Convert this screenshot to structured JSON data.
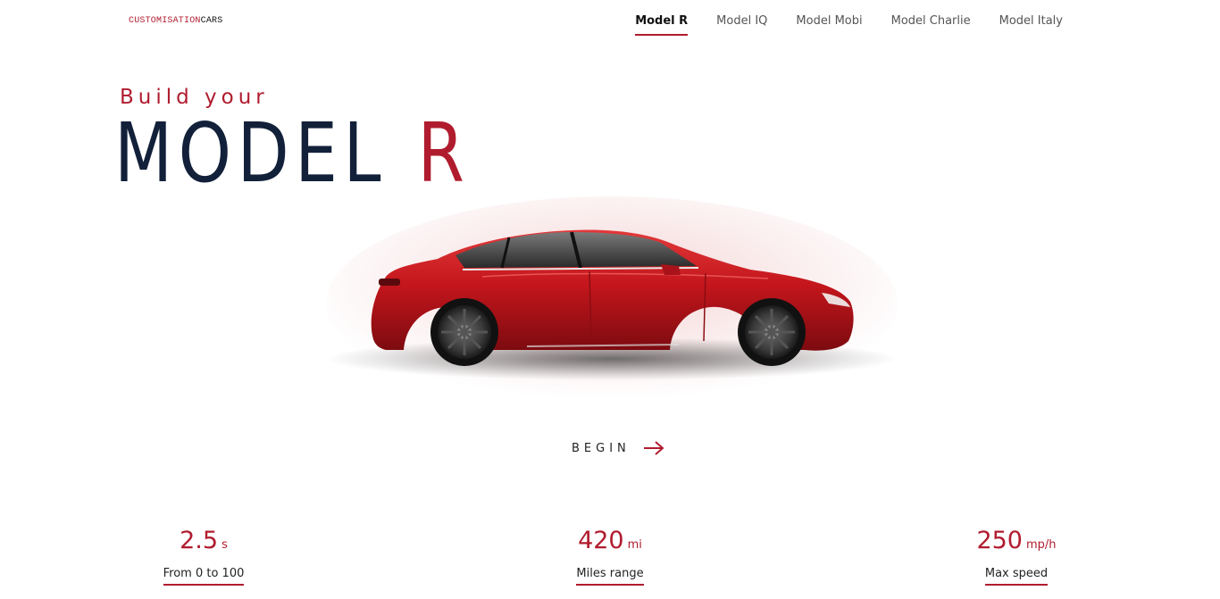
{
  "logo": {
    "part1": "CUSTOMISATION",
    "part2": "CARS"
  },
  "nav": {
    "items": [
      {
        "label": "Model R"
      },
      {
        "label": "Model IQ"
      },
      {
        "label": "Model Mobi"
      },
      {
        "label": "Model Charlie"
      },
      {
        "label": "Model Italy"
      }
    ],
    "active_index": 0
  },
  "hero": {
    "subtitle": "Build your",
    "title_main": "MODEL",
    "title_accent": "R",
    "car_color": "#c4161c"
  },
  "begin": {
    "label": "BEGIN",
    "icon": "arrow-right-icon"
  },
  "stats": [
    {
      "value": "2.5",
      "unit": "s",
      "label": "From 0 to 100"
    },
    {
      "value": "420",
      "unit": "mi",
      "label": "Miles range"
    },
    {
      "value": "250",
      "unit": "mp/h",
      "label": "Max speed"
    }
  ],
  "colors": {
    "accent": "#b01c2e",
    "title": "#12203a"
  }
}
